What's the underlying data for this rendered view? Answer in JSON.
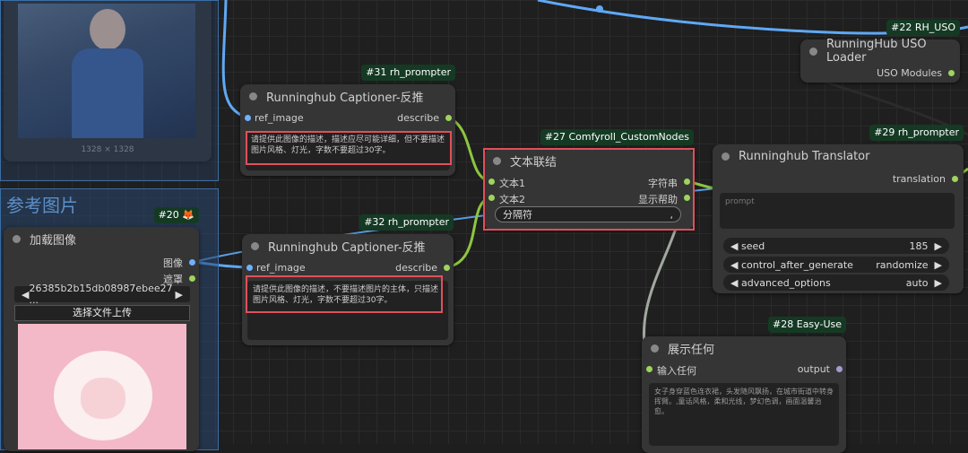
{
  "groups": {
    "ref_group_title": "参考图片"
  },
  "image_node": {
    "dimensions": "1328 × 1328"
  },
  "load_image": {
    "badge": "#20 🦊",
    "title": "加载图像",
    "output_image": "图像",
    "output_mask": "遮罩",
    "file_name": "26385b2b15db08987ebee27 ...",
    "upload_label": "选择文件上传"
  },
  "captioner_31": {
    "badge": "#31 rh_prompter",
    "title": "Runninghub Captioner-反推",
    "input_label": "ref_image",
    "output_label": "describe",
    "prompt": "请提供此图像的描述，描述应尽可能详细，但不要描述图片风格、灯光，字数不要超过30字。"
  },
  "captioner_32": {
    "badge": "#32 rh_prompter",
    "title": "Runninghub Captioner-反推",
    "input_label": "ref_image",
    "output_label": "describe",
    "prompt": "请提供此图像的描述，不要描述图片的主体，只描述图片风格、灯光，字数不要超过30字。"
  },
  "concat_27": {
    "badge": "#27 Comfyroll_CustomNodes",
    "title": "文本联结",
    "input_1": "文本1",
    "input_2": "文本2",
    "output_1": "字符串",
    "output_2": "显示帮助",
    "separator_label": "分隔符",
    "separator_value": ","
  },
  "uso_22": {
    "badge": "#22 RH_USO",
    "title": "RunningHub USO Loader",
    "output": "USO Modules"
  },
  "translator_29": {
    "badge": "#29 rh_prompter",
    "title": "Runninghub Translator",
    "output": "translation",
    "placeholder": "prompt",
    "seed_label": "seed",
    "seed_value": "185",
    "cag_label": "control_after_generate",
    "cag_value": "randomize",
    "adv_label": "advanced_options",
    "adv_value": "auto"
  },
  "show_28": {
    "badge": "#28 Easy-Use",
    "title": "展示任何",
    "input": "输入任何",
    "output": "output",
    "text": "女子身穿蓝色连衣裙，头发随风飘扬，在城市街道中转身挥臂。,童话风格，柔和光线，梦幻色调，画面温馨治愈。"
  },
  "colors": {
    "wire_blue": "#5fa8f5",
    "wire_green": "#8cc63f",
    "wire_gray": "#a0a8a0",
    "highlight_red": "#e0505a"
  }
}
